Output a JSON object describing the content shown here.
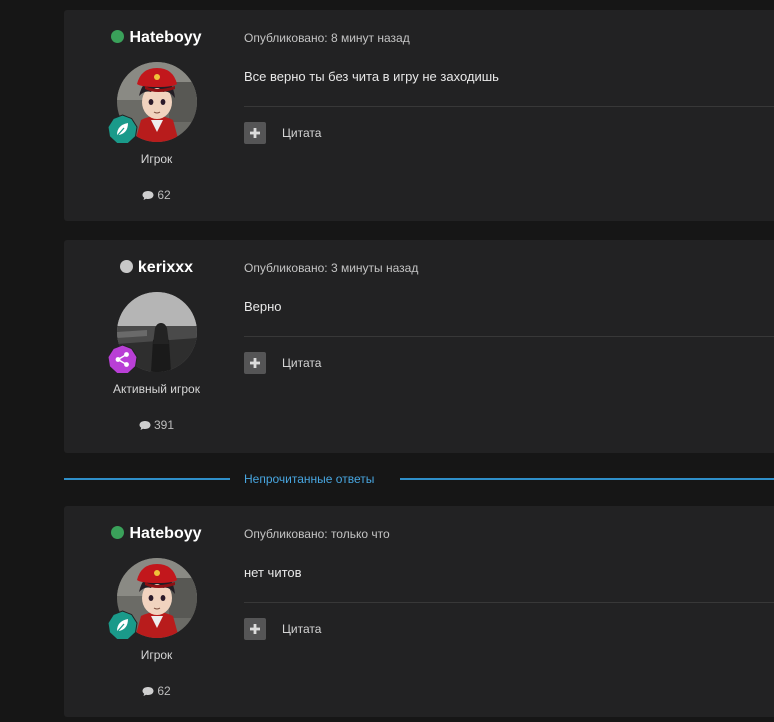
{
  "colors": {
    "page_bg": "#161616",
    "post_bg": "#222223",
    "online": "#3aa15a",
    "offline": "#c8c8c8",
    "unread_accent": "#48a6e0",
    "badge_teal": "#1a9a8a",
    "badge_purple": "#b93fd6"
  },
  "posts": [
    {
      "author": "Hateboyy",
      "status": "online",
      "rank_title": "Игрок",
      "rank_icon": "leaf-icon",
      "post_count": "62",
      "meta": "Опубликовано: 8 минут назад",
      "body": "Все верно ты без чита в игру не заходишь",
      "quote_label": "Цитата"
    },
    {
      "author": "kerixxx",
      "status": "offline",
      "rank_title": "Активный игрок",
      "rank_icon": "share-icon",
      "post_count": "391",
      "meta": "Опубликовано: 3 минуты назад",
      "body": "Верно",
      "quote_label": "Цитата"
    },
    {
      "author": "Hateboyy",
      "status": "online",
      "rank_title": "Игрок",
      "rank_icon": "leaf-icon",
      "post_count": "62",
      "meta": "Опубликовано: только что",
      "body": "нет читов",
      "quote_label": "Цитата"
    }
  ],
  "unread_separator": "Непрочитанные ответы"
}
